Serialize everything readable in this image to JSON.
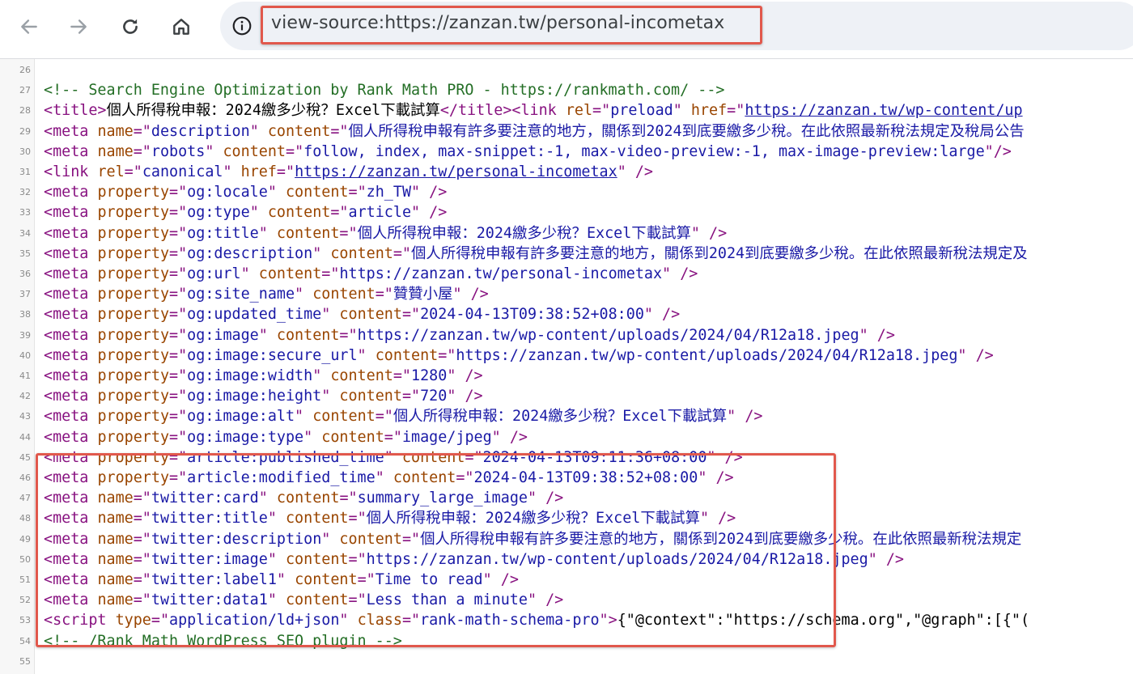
{
  "toolbar": {
    "back_icon": "arrow-left-icon",
    "forward_icon": "arrow-right-icon",
    "reload_icon": "reload-icon",
    "home_icon": "home-icon",
    "url": "view-source:https://zanzan.tw/personal-incometax"
  },
  "lines": [
    {
      "n": "26",
      "segs": []
    },
    {
      "n": "27",
      "segs": [
        [
          "c",
          "<!-- Search Engine Optimization by Rank Math PRO - https://rankmath.com/ -->"
        ]
      ]
    },
    {
      "n": "28",
      "segs": [
        [
          "t",
          "<title>"
        ],
        [
          "pl",
          "個人所得稅申報：2024繳多少稅？Excel下載試算"
        ],
        [
          "t",
          "</title><link "
        ],
        [
          "a",
          "rel"
        ],
        [
          "t",
          "=\""
        ],
        [
          "v",
          "preload"
        ],
        [
          "t",
          "\" "
        ],
        [
          "a",
          "href"
        ],
        [
          "t",
          "=\""
        ],
        [
          "lnk",
          "https://zanzan.tw/wp-content/up"
        ]
      ]
    },
    {
      "n": "29",
      "segs": [
        [
          "t",
          "<meta "
        ],
        [
          "a",
          "name"
        ],
        [
          "t",
          "=\""
        ],
        [
          "v",
          "description"
        ],
        [
          "t",
          "\" "
        ],
        [
          "a",
          "content"
        ],
        [
          "t",
          "=\""
        ],
        [
          "v",
          "個人所得稅申報有許多要注意的地方，關係到2024到底要繳多少稅。在此依照最新稅法規定及稅局公告"
        ]
      ]
    },
    {
      "n": "30",
      "segs": [
        [
          "t",
          "<meta "
        ],
        [
          "a",
          "name"
        ],
        [
          "t",
          "=\""
        ],
        [
          "v",
          "robots"
        ],
        [
          "t",
          "\" "
        ],
        [
          "a",
          "content"
        ],
        [
          "t",
          "=\""
        ],
        [
          "v",
          "follow, index, max-snippet:-1, max-video-preview:-1, max-image-preview:large"
        ],
        [
          "t",
          "\"/>"
        ]
      ]
    },
    {
      "n": "31",
      "segs": [
        [
          "t",
          "<link "
        ],
        [
          "a",
          "rel"
        ],
        [
          "t",
          "=\""
        ],
        [
          "v",
          "canonical"
        ],
        [
          "t",
          "\" "
        ],
        [
          "a",
          "href"
        ],
        [
          "t",
          "=\""
        ],
        [
          "lnk",
          "https://zanzan.tw/personal-incometax"
        ],
        [
          "t",
          "\" />"
        ]
      ]
    },
    {
      "n": "32",
      "segs": [
        [
          "t",
          "<meta "
        ],
        [
          "a",
          "property"
        ],
        [
          "t",
          "=\""
        ],
        [
          "v",
          "og:locale"
        ],
        [
          "t",
          "\" "
        ],
        [
          "a",
          "content"
        ],
        [
          "t",
          "=\""
        ],
        [
          "v",
          "zh_TW"
        ],
        [
          "t",
          "\" />"
        ]
      ]
    },
    {
      "n": "33",
      "segs": [
        [
          "t",
          "<meta "
        ],
        [
          "a",
          "property"
        ],
        [
          "t",
          "=\""
        ],
        [
          "v",
          "og:type"
        ],
        [
          "t",
          "\" "
        ],
        [
          "a",
          "content"
        ],
        [
          "t",
          "=\""
        ],
        [
          "v",
          "article"
        ],
        [
          "t",
          "\" />"
        ]
      ]
    },
    {
      "n": "34",
      "segs": [
        [
          "t",
          "<meta "
        ],
        [
          "a",
          "property"
        ],
        [
          "t",
          "=\""
        ],
        [
          "v",
          "og:title"
        ],
        [
          "t",
          "\" "
        ],
        [
          "a",
          "content"
        ],
        [
          "t",
          "=\""
        ],
        [
          "v",
          "個人所得稅申報：2024繳多少稅？Excel下載試算"
        ],
        [
          "t",
          "\" />"
        ]
      ]
    },
    {
      "n": "35",
      "segs": [
        [
          "t",
          "<meta "
        ],
        [
          "a",
          "property"
        ],
        [
          "t",
          "=\""
        ],
        [
          "v",
          "og:description"
        ],
        [
          "t",
          "\" "
        ],
        [
          "a",
          "content"
        ],
        [
          "t",
          "=\""
        ],
        [
          "v",
          "個人所得稅申報有許多要注意的地方，關係到2024到底要繳多少稅。在此依照最新稅法規定及"
        ]
      ]
    },
    {
      "n": "36",
      "segs": [
        [
          "t",
          "<meta "
        ],
        [
          "a",
          "property"
        ],
        [
          "t",
          "=\""
        ],
        [
          "v",
          "og:url"
        ],
        [
          "t",
          "\" "
        ],
        [
          "a",
          "content"
        ],
        [
          "t",
          "=\""
        ],
        [
          "v",
          "https://zanzan.tw/personal-incometax"
        ],
        [
          "t",
          "\" />"
        ]
      ]
    },
    {
      "n": "37",
      "segs": [
        [
          "t",
          "<meta "
        ],
        [
          "a",
          "property"
        ],
        [
          "t",
          "=\""
        ],
        [
          "v",
          "og:site_name"
        ],
        [
          "t",
          "\" "
        ],
        [
          "a",
          "content"
        ],
        [
          "t",
          "=\""
        ],
        [
          "v",
          "贊贊小屋"
        ],
        [
          "t",
          "\" />"
        ]
      ]
    },
    {
      "n": "38",
      "segs": [
        [
          "t",
          "<meta "
        ],
        [
          "a",
          "property"
        ],
        [
          "t",
          "=\""
        ],
        [
          "v",
          "og:updated_time"
        ],
        [
          "t",
          "\" "
        ],
        [
          "a",
          "content"
        ],
        [
          "t",
          "=\""
        ],
        [
          "v",
          "2024-04-13T09:38:52+08:00"
        ],
        [
          "t",
          "\" />"
        ]
      ]
    },
    {
      "n": "39",
      "segs": [
        [
          "t",
          "<meta "
        ],
        [
          "a",
          "property"
        ],
        [
          "t",
          "=\""
        ],
        [
          "v",
          "og:image"
        ],
        [
          "t",
          "\" "
        ],
        [
          "a",
          "content"
        ],
        [
          "t",
          "=\""
        ],
        [
          "v",
          "https://zanzan.tw/wp-content/uploads/2024/04/R12a18.jpeg"
        ],
        [
          "t",
          "\" />"
        ]
      ]
    },
    {
      "n": "40",
      "segs": [
        [
          "t",
          "<meta "
        ],
        [
          "a",
          "property"
        ],
        [
          "t",
          "=\""
        ],
        [
          "v",
          "og:image:secure_url"
        ],
        [
          "t",
          "\" "
        ],
        [
          "a",
          "content"
        ],
        [
          "t",
          "=\""
        ],
        [
          "v",
          "https://zanzan.tw/wp-content/uploads/2024/04/R12a18.jpeg"
        ],
        [
          "t",
          "\" />"
        ]
      ]
    },
    {
      "n": "41",
      "segs": [
        [
          "t",
          "<meta "
        ],
        [
          "a",
          "property"
        ],
        [
          "t",
          "=\""
        ],
        [
          "v",
          "og:image:width"
        ],
        [
          "t",
          "\" "
        ],
        [
          "a",
          "content"
        ],
        [
          "t",
          "=\""
        ],
        [
          "v",
          "1280"
        ],
        [
          "t",
          "\" />"
        ]
      ]
    },
    {
      "n": "42",
      "segs": [
        [
          "t",
          "<meta "
        ],
        [
          "a",
          "property"
        ],
        [
          "t",
          "=\""
        ],
        [
          "v",
          "og:image:height"
        ],
        [
          "t",
          "\" "
        ],
        [
          "a",
          "content"
        ],
        [
          "t",
          "=\""
        ],
        [
          "v",
          "720"
        ],
        [
          "t",
          "\" />"
        ]
      ]
    },
    {
      "n": "43",
      "segs": [
        [
          "t",
          "<meta "
        ],
        [
          "a",
          "property"
        ],
        [
          "t",
          "=\""
        ],
        [
          "v",
          "og:image:alt"
        ],
        [
          "t",
          "\" "
        ],
        [
          "a",
          "content"
        ],
        [
          "t",
          "=\""
        ],
        [
          "v",
          "個人所得稅申報：2024繳多少稅？Excel下載試算"
        ],
        [
          "t",
          "\" />"
        ]
      ]
    },
    {
      "n": "44",
      "segs": [
        [
          "t",
          "<meta "
        ],
        [
          "a",
          "property"
        ],
        [
          "t",
          "=\""
        ],
        [
          "v",
          "og:image:type"
        ],
        [
          "t",
          "\" "
        ],
        [
          "a",
          "content"
        ],
        [
          "t",
          "=\""
        ],
        [
          "v",
          "image/jpeg"
        ],
        [
          "t",
          "\" />"
        ]
      ]
    },
    {
      "n": "45",
      "segs": [
        [
          "t",
          "<meta "
        ],
        [
          "a",
          "property"
        ],
        [
          "t",
          "=\""
        ],
        [
          "v",
          "article:published_time"
        ],
        [
          "t",
          "\" "
        ],
        [
          "a",
          "content"
        ],
        [
          "t",
          "=\""
        ],
        [
          "v",
          "2024-04-13T09:11:36+08:00"
        ],
        [
          "t",
          "\" />"
        ]
      ]
    },
    {
      "n": "46",
      "segs": [
        [
          "t",
          "<meta "
        ],
        [
          "a",
          "property"
        ],
        [
          "t",
          "=\""
        ],
        [
          "v",
          "article:modified_time"
        ],
        [
          "t",
          "\" "
        ],
        [
          "a",
          "content"
        ],
        [
          "t",
          "=\""
        ],
        [
          "v",
          "2024-04-13T09:38:52+08:00"
        ],
        [
          "t",
          "\" />"
        ]
      ]
    },
    {
      "n": "47",
      "segs": [
        [
          "t",
          "<meta "
        ],
        [
          "a",
          "name"
        ],
        [
          "t",
          "=\""
        ],
        [
          "v",
          "twitter:card"
        ],
        [
          "t",
          "\" "
        ],
        [
          "a",
          "content"
        ],
        [
          "t",
          "=\""
        ],
        [
          "v",
          "summary_large_image"
        ],
        [
          "t",
          "\" />"
        ]
      ]
    },
    {
      "n": "48",
      "segs": [
        [
          "t",
          "<meta "
        ],
        [
          "a",
          "name"
        ],
        [
          "t",
          "=\""
        ],
        [
          "v",
          "twitter:title"
        ],
        [
          "t",
          "\" "
        ],
        [
          "a",
          "content"
        ],
        [
          "t",
          "=\""
        ],
        [
          "v",
          "個人所得稅申報：2024繳多少稅？Excel下載試算"
        ],
        [
          "t",
          "\" />"
        ]
      ]
    },
    {
      "n": "49",
      "segs": [
        [
          "t",
          "<meta "
        ],
        [
          "a",
          "name"
        ],
        [
          "t",
          "=\""
        ],
        [
          "v",
          "twitter:description"
        ],
        [
          "t",
          "\" "
        ],
        [
          "a",
          "content"
        ],
        [
          "t",
          "=\""
        ],
        [
          "v",
          "個人所得稅申報有許多要注意的地方，關係到2024到底要繳多少稅。在此依照最新稅法規定"
        ]
      ]
    },
    {
      "n": "50",
      "segs": [
        [
          "t",
          "<meta "
        ],
        [
          "a",
          "name"
        ],
        [
          "t",
          "=\""
        ],
        [
          "v",
          "twitter:image"
        ],
        [
          "t",
          "\" "
        ],
        [
          "a",
          "content"
        ],
        [
          "t",
          "=\""
        ],
        [
          "v",
          "https://zanzan.tw/wp-content/uploads/2024/04/R12a18.jpeg"
        ],
        [
          "t",
          "\" />"
        ]
      ]
    },
    {
      "n": "51",
      "segs": [
        [
          "t",
          "<meta "
        ],
        [
          "a",
          "name"
        ],
        [
          "t",
          "=\""
        ],
        [
          "v",
          "twitter:label1"
        ],
        [
          "t",
          "\" "
        ],
        [
          "a",
          "content"
        ],
        [
          "t",
          "=\""
        ],
        [
          "v",
          "Time to read"
        ],
        [
          "t",
          "\" />"
        ]
      ]
    },
    {
      "n": "52",
      "segs": [
        [
          "t",
          "<meta "
        ],
        [
          "a",
          "name"
        ],
        [
          "t",
          "=\""
        ],
        [
          "v",
          "twitter:data1"
        ],
        [
          "t",
          "\" "
        ],
        [
          "a",
          "content"
        ],
        [
          "t",
          "=\""
        ],
        [
          "v",
          "Less than a minute"
        ],
        [
          "t",
          "\" />"
        ]
      ]
    },
    {
      "n": "53",
      "segs": [
        [
          "t",
          "<script "
        ],
        [
          "a",
          "type"
        ],
        [
          "t",
          "=\""
        ],
        [
          "v",
          "application/ld+json"
        ],
        [
          "t",
          "\" "
        ],
        [
          "a",
          "class"
        ],
        [
          "t",
          "=\""
        ],
        [
          "v",
          "rank-math-schema-pro"
        ],
        [
          "t",
          "\">"
        ],
        [
          "pl",
          "{\"@context\":\"https://schema.org\",\"@graph\":[{\"("
        ]
      ]
    },
    {
      "n": "54",
      "segs": [
        [
          "c",
          "<!-- /Rank Math WordPress SEO plugin -->"
        ]
      ]
    },
    {
      "n": "55",
      "segs": []
    }
  ]
}
